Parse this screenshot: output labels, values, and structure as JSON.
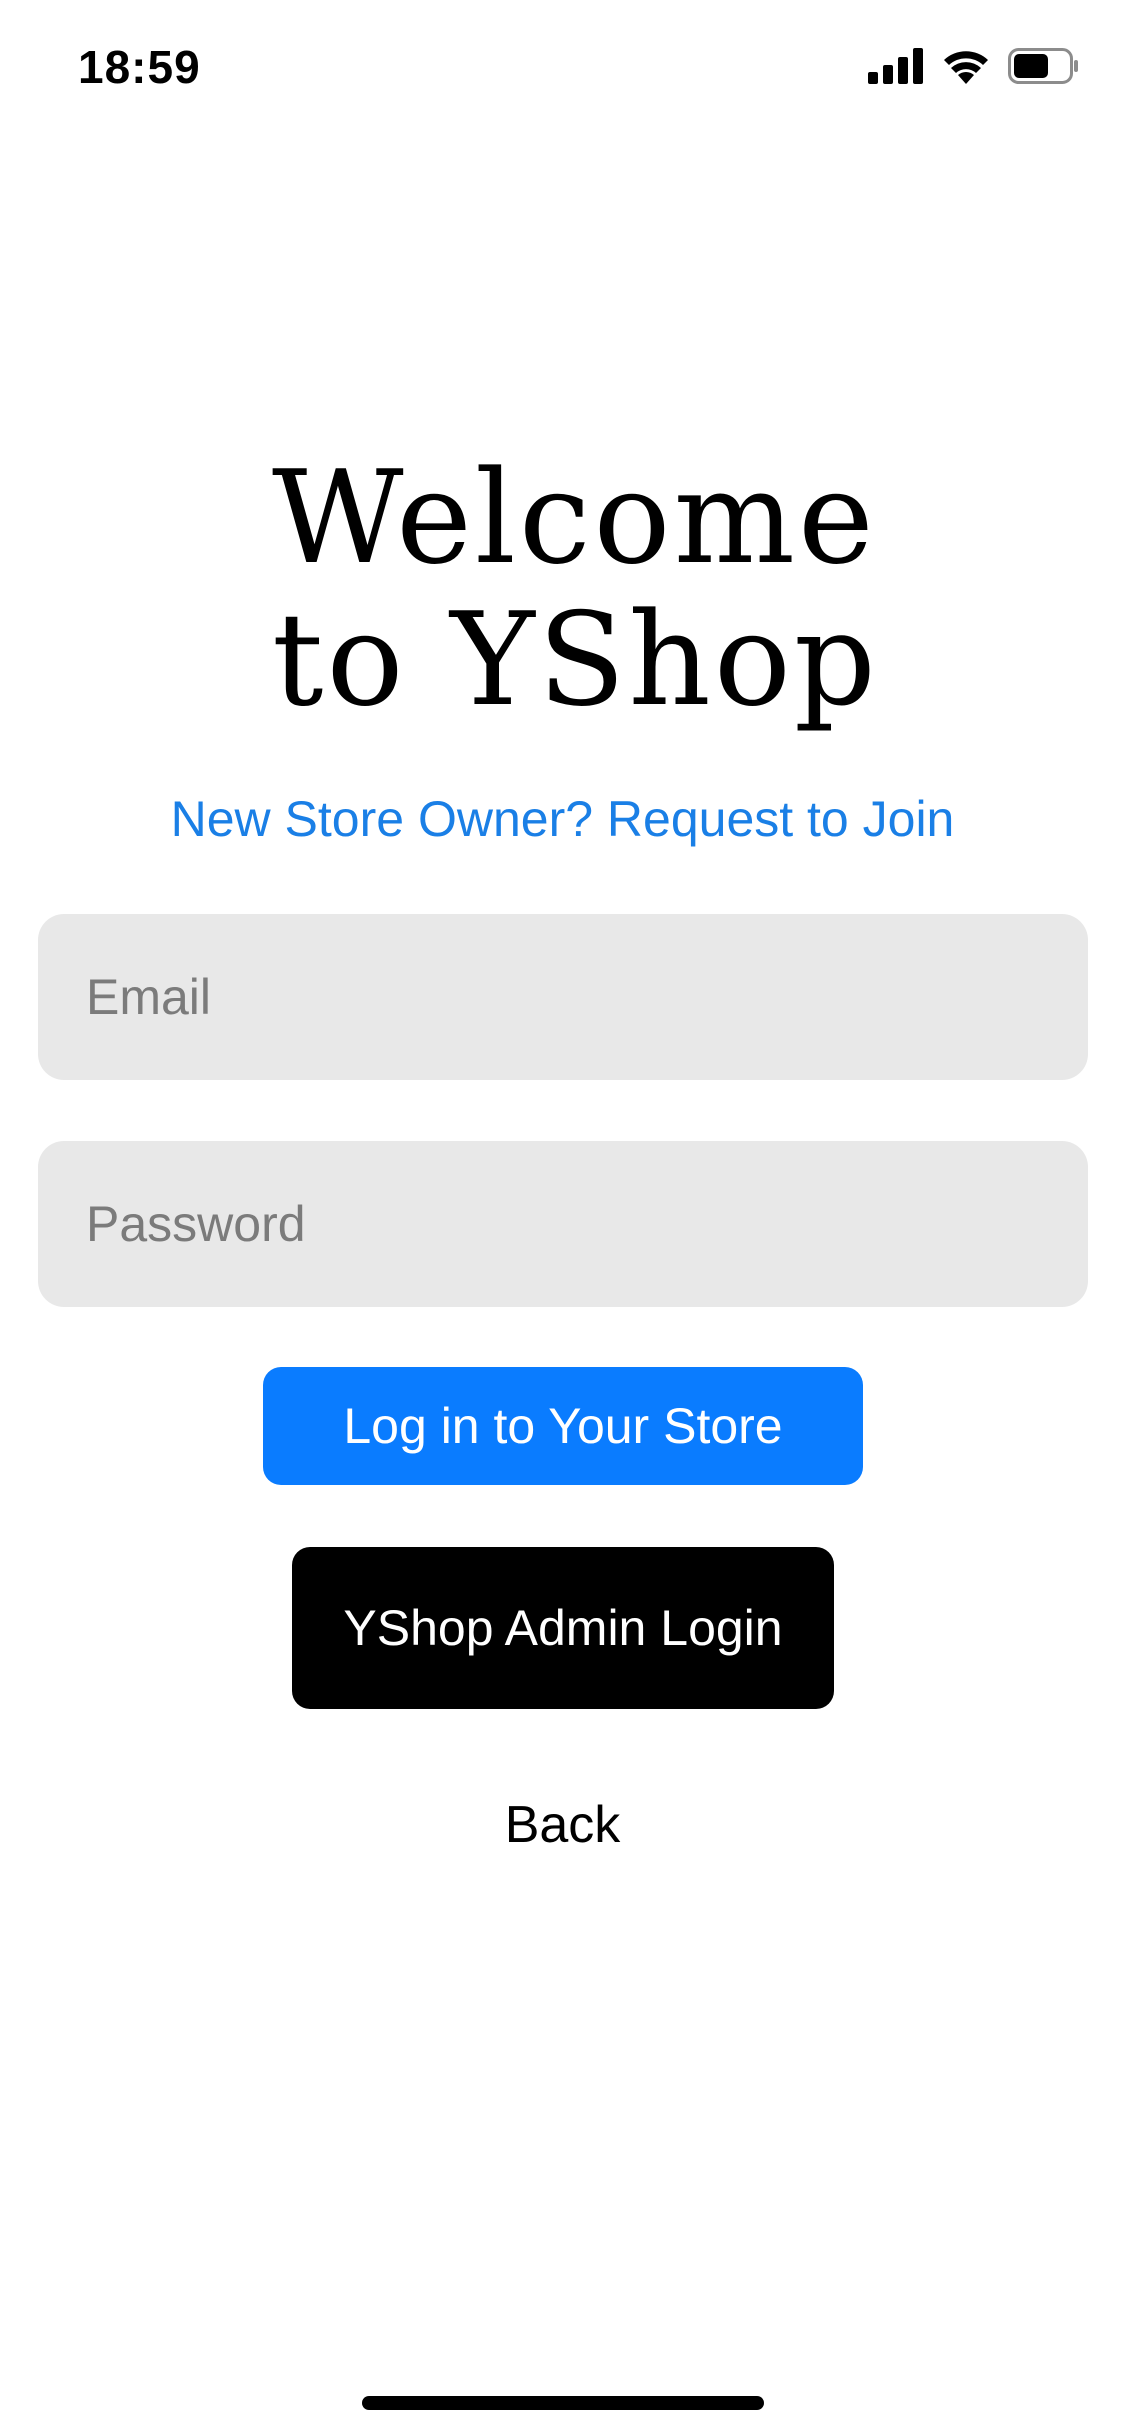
{
  "status_bar": {
    "time": "18:59",
    "icons": [
      "cellular-signal-icon",
      "wifi-icon",
      "battery-icon"
    ],
    "battery_level": 0.65
  },
  "title": {
    "line1": "Welcome",
    "line2": "to YShop"
  },
  "join_link": "New Store Owner? Request to Join",
  "email_field": {
    "placeholder": "Email",
    "value": ""
  },
  "password_field": {
    "placeholder": "Password",
    "value": ""
  },
  "buttons": {
    "login": "Log in to Your Store",
    "admin_login": "YShop Admin Login",
    "back": "Back"
  },
  "colors": {
    "accent": "#0a7cff",
    "link": "#1a7fe6",
    "field_bg": "#e8e8e8",
    "admin_button": "#000000"
  }
}
